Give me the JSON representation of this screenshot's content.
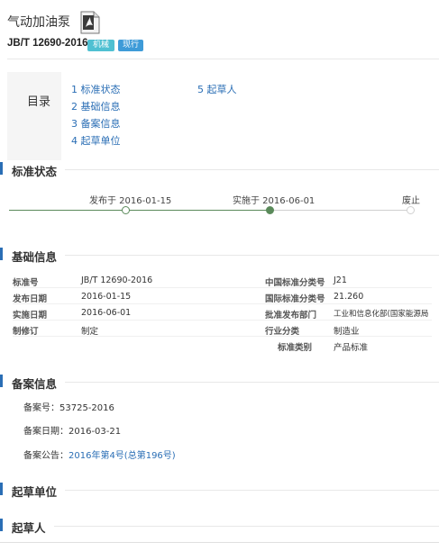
{
  "header": {
    "title": "气动加油泵",
    "std_no": "JB/T 12690-2016",
    "badge_category": "机械",
    "badge_status": "现行",
    "pdf_icon": "pdf-file-icon"
  },
  "toc": {
    "label": "目录",
    "items": [
      {
        "label": "1  标准状态"
      },
      {
        "label": "2  基础信息"
      },
      {
        "label": "3  备案信息"
      },
      {
        "label": "4  起草单位"
      },
      {
        "label": "5  起草人"
      }
    ]
  },
  "status": {
    "title": "标准状态",
    "published": "发布于 2016-01-15",
    "implemented": "实施于 2016-06-01",
    "abolished": "废止"
  },
  "basic": {
    "title": "基础信息",
    "rows": [
      {
        "k1": "标准号",
        "v1": "JB/T 12690-2016",
        "k2": "中国标准分类号",
        "v2": "J21"
      },
      {
        "k1": "发布日期",
        "v1": "2016-01-15",
        "k2": "国际标准分类号",
        "v2": "21.260"
      },
      {
        "k1": "实施日期",
        "v1": "2016-06-01",
        "k2": "批准发布部门",
        "v2": "工业和信息化部(国家能源局"
      },
      {
        "k1": "制修订",
        "v1": "制定",
        "k2": "行业分类",
        "v2": "制造业"
      },
      {
        "k1": "",
        "v1": "",
        "k2": "标准类别",
        "v2": "产品标准"
      }
    ]
  },
  "record": {
    "title": "备案信息",
    "no_label": "备案号：",
    "no_value": "53725-2016",
    "date_label": "备案日期：",
    "date_value": "2016-03-21",
    "notice_label": "备案公告：",
    "notice_value": "2016年第4号(总第196号)"
  },
  "drafting_unit": {
    "title": "起草单位"
  },
  "drafters": {
    "title": "起草人"
  },
  "colors": {
    "accent": "#2a6eb5",
    "done": "#5a8a5a",
    "badge_cat": "#4fc0d2",
    "badge_status": "#3e9bd8"
  }
}
